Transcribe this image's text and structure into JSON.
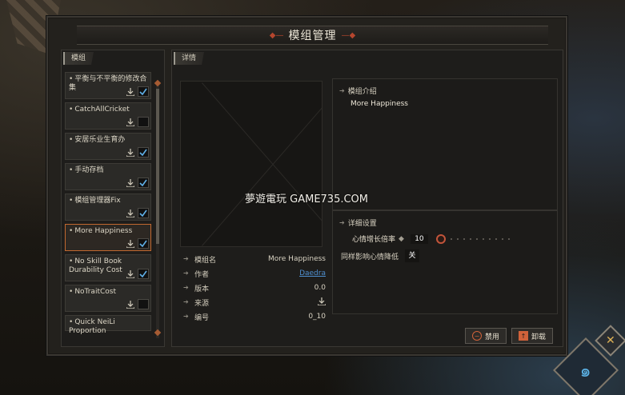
{
  "window": {
    "title": "模组管理"
  },
  "left_panel": {
    "tab_label": "模组",
    "mods": [
      {
        "name": "平衡与不平衡的修改合集",
        "checked": true
      },
      {
        "name": "CatchAllCricket",
        "checked": false
      },
      {
        "name": "安居乐业生育办",
        "checked": true
      },
      {
        "name": "手动存档",
        "checked": true
      },
      {
        "name": "模组管理器Fix",
        "checked": true
      },
      {
        "name": "More Happiness",
        "checked": true,
        "selected": true
      },
      {
        "name": "No Skill Book Durability Cost",
        "checked": true
      },
      {
        "name": "NoTraitCost",
        "checked": false
      },
      {
        "name": "Quick NeiLi Proportion",
        "checked": false
      }
    ]
  },
  "right_panel": {
    "tab_label": "详情",
    "info": [
      {
        "key": "模组名",
        "value": "More Happiness"
      },
      {
        "key": "作者",
        "value": "Daedra"
      },
      {
        "key": "版本",
        "value": "0.0"
      },
      {
        "key": "来源",
        "value": ""
      },
      {
        "key": "编号",
        "value": "0_10"
      }
    ],
    "intro": {
      "header": "模组介绍",
      "text": "More Happiness"
    },
    "details": {
      "header": "详细设置",
      "setting1_label": "心情增长倍率",
      "setting1_value": "10",
      "setting2_label": "同样影响心情降低",
      "setting2_value": "关"
    },
    "buttons": {
      "disable": "禁用",
      "uninstall": "卸载"
    }
  },
  "watermark": "夢遊電玩 GAME735.COM",
  "colors": {
    "accent": "#c1682f",
    "link": "#4f8fcf"
  }
}
